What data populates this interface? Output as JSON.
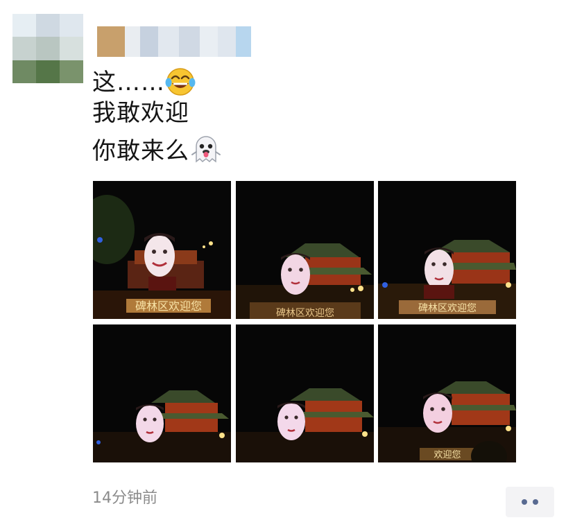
{
  "post": {
    "lines": [
      "这……",
      "我敢欢迎",
      "你敢来么"
    ],
    "emoji_1": "laughing-tears-emoji",
    "emoji_2": "ghost-tongue-emoji",
    "timestamp": "14分钟前",
    "more_icon": "more-dots-icon"
  },
  "photos": [
    {
      "id": "photo-1",
      "sign_text": "碑林区欢迎您"
    },
    {
      "id": "photo-2",
      "sign_text": "碑林区欢迎您"
    },
    {
      "id": "photo-3",
      "sign_text": "碑林区欢迎您"
    },
    {
      "id": "photo-4",
      "sign_text": ""
    },
    {
      "id": "photo-5",
      "sign_text": ""
    },
    {
      "id": "photo-6",
      "sign_text": "欢迎您"
    }
  ],
  "colors": {
    "text": "#151515",
    "timestamp": "#8b8b8b",
    "more_dots": "#586a91",
    "photo_bg": "#060606"
  }
}
